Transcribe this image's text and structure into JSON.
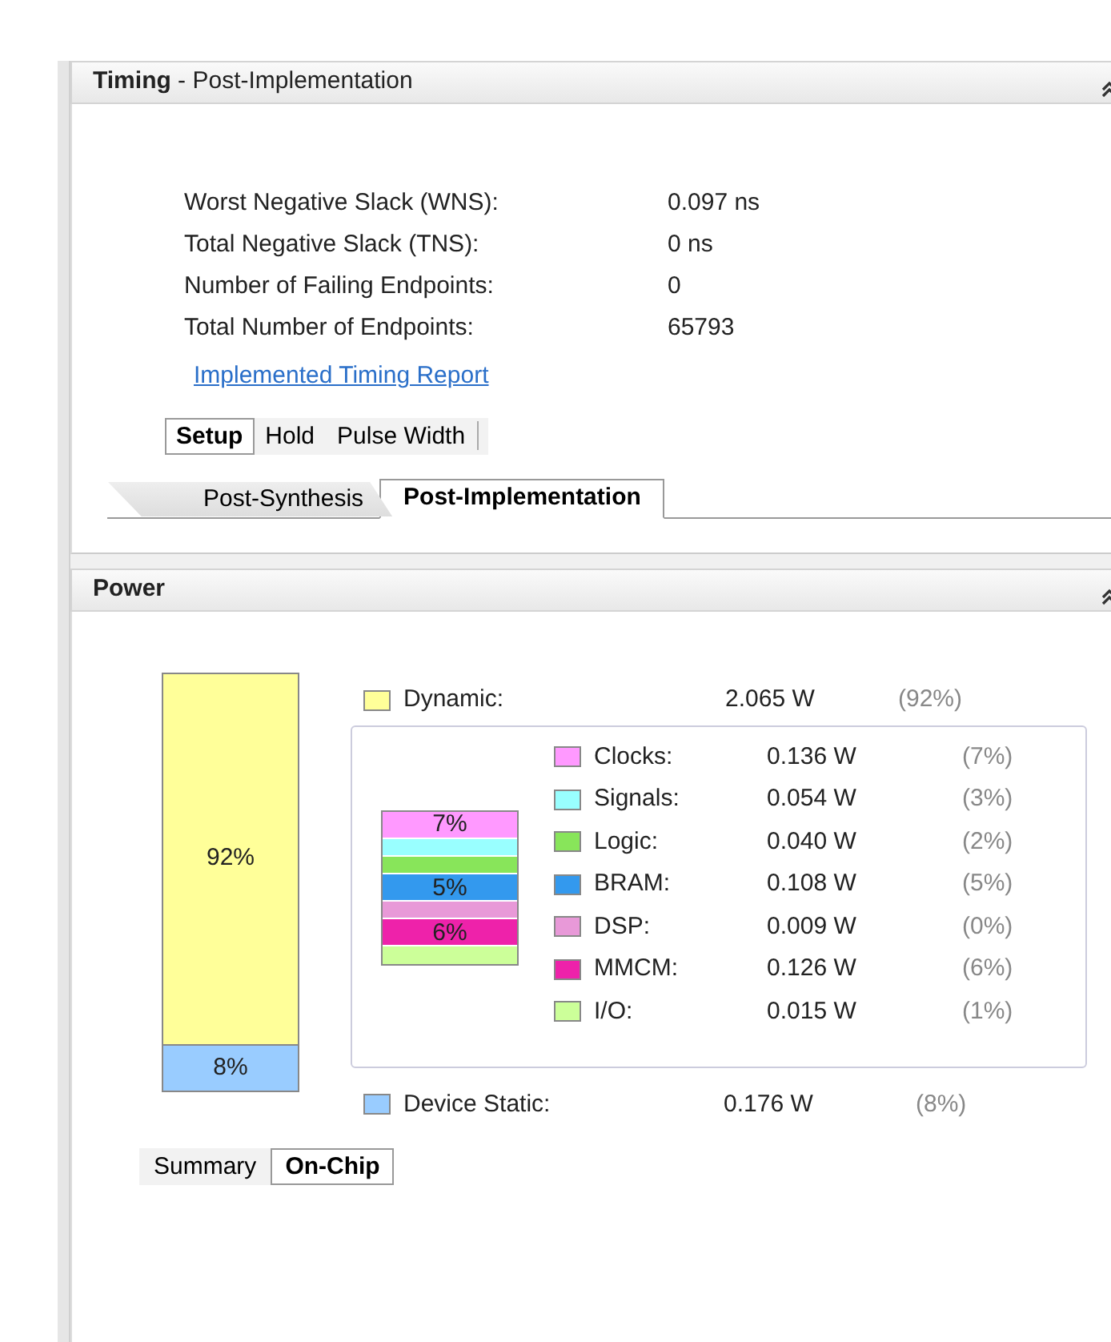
{
  "timing": {
    "title": "**Timing** - Post-Implementation",
    "metrics": [
      {
        "label": "Worst Negative Slack (WNS):",
        "value": "0.097 ns"
      },
      {
        "label": "Total Negative Slack (TNS):",
        "value": "0 ns"
      },
      {
        "label": "Number of Failing Endpoints:",
        "value": "0"
      },
      {
        "label": "Total Number of Endpoints:",
        "value": "65793"
      }
    ],
    "link": "Implemented Timing Report",
    "check_tabs": [
      {
        "label": "Setup",
        "selected": true
      },
      {
        "label": "Hold",
        "selected": false
      },
      {
        "label": "Pulse Width",
        "selected": false
      }
    ],
    "run_tabs": [
      {
        "label": "Post-Synthesis",
        "selected": false
      },
      {
        "label": "Post-Implementation",
        "selected": true
      }
    ]
  },
  "power": {
    "title": "Power",
    "total_bar": [
      {
        "label": "92%",
        "color": "#ffff99",
        "level": 0.89
      },
      {
        "label": "8%",
        "color": "#99ccff",
        "level": 0.11
      }
    ],
    "dynamic": {
      "label": "Dynamic:",
      "value": "2.065 W",
      "percent": "(92%)",
      "color": "#ffff99"
    },
    "dynamic_bar": [
      {
        "label": "7%",
        "color": "#ff99ff"
      },
      {
        "color": "#99ffff"
      },
      {
        "color": "#88e55a"
      },
      {
        "label": "5%",
        "color": "#3399ee"
      },
      {
        "color": "#e899d8"
      },
      {
        "label": "6%",
        "color": "#ee22aa"
      },
      {
        "color": "#ccff99"
      }
    ],
    "breakdown": [
      {
        "label": "Clocks:",
        "value": "0.136 W",
        "percent": "(7%)",
        "color": "#ff99ff"
      },
      {
        "label": "Signals:",
        "value": "0.054 W",
        "percent": "(3%)",
        "color": "#99ffff"
      },
      {
        "label": "Logic:",
        "value": "0.040 W",
        "percent": "(2%)",
        "color": "#88e55a"
      },
      {
        "label": "BRAM:",
        "value": "0.108 W",
        "percent": "(5%)",
        "color": "#3399ee"
      },
      {
        "label": "DSP:",
        "value": "0.009 W",
        "percent": "(0%)",
        "color": "#e899d8"
      },
      {
        "label": "MMCM:",
        "value": "0.126 W",
        "percent": "(6%)",
        "color": "#ee22aa"
      },
      {
        "label": "I/O:",
        "value": "0.015 W",
        "percent": "(1%)",
        "color": "#ccff99"
      }
    ],
    "static": {
      "label": "Device Static:",
      "value": "0.176 W",
      "percent": "(8%)",
      "color": "#99ccff"
    },
    "view_tabs": [
      {
        "label": "Summary",
        "selected": false
      },
      {
        "label": "On-Chip",
        "selected": true
      }
    ]
  }
}
